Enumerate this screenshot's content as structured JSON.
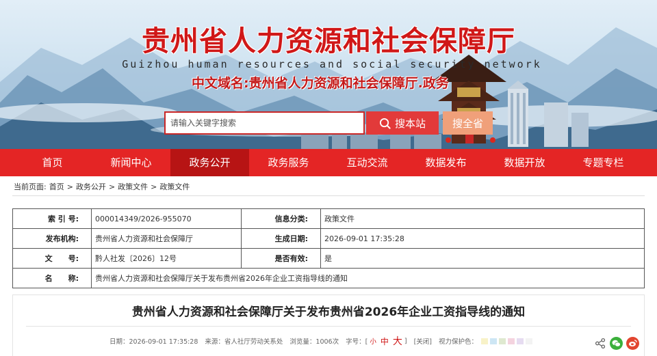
{
  "header": {
    "title": "贵州省人力资源和社会保障厅",
    "subtitle": "Guizhou human resources and social security network",
    "domain": "中文域名:贵州省人力资源和社会保障厅.政务"
  },
  "search": {
    "placeholder": "请输入关键字搜索",
    "search_label": "搜本站",
    "search_all_label": "搜全省"
  },
  "nav": {
    "items": [
      "首页",
      "新闻中心",
      "政务公开",
      "政务服务",
      "互动交流",
      "数据发布",
      "数据开放",
      "专题专栏"
    ],
    "active_index": 2
  },
  "breadcrumb": {
    "prefix": "当前页面:",
    "items": [
      "首页",
      "政务公开",
      "政策文件",
      "政策文件"
    ],
    "separator": ">"
  },
  "info": {
    "index_label": "索 引 号:",
    "index_value": "000014349/2026-955070",
    "category_label": "信息分类:",
    "category_value": "政策文件",
    "publisher_label": "发布机构:",
    "publisher_value": "贵州省人力资源和社会保障厅",
    "date_label": "生成日期:",
    "date_value": "2026-09-01 17:35:28",
    "docno_label": "文      号:",
    "docno_value": "黔人社发〔2026〕12号",
    "valid_label": "是否有效:",
    "valid_value": "是",
    "name_label": "名      称:",
    "name_value": "贵州省人力资源和社会保障厅关于发布贵州省2026年企业工资指导线的通知"
  },
  "article": {
    "title": "贵州省人力资源和社会保障厅关于发布贵州省2026年企业工资指导线的通知",
    "date": "日期：2026-09-01 17:35:28",
    "source": "来源：省人社厅劳动关系处",
    "views": "浏览量：1006次",
    "font_label": "字号：[",
    "font_small": "小",
    "font_medium": "中",
    "font_large": "大",
    "font_end": "]",
    "close_label": "[关闭]",
    "color_label": "视力保护色：",
    "swatches": [
      "#f8f2c8",
      "#cde6f4",
      "#dfe9d0",
      "#f4d3df",
      "#e6dcf1",
      "#f3f3f3"
    ]
  },
  "colors": {
    "brand_red": "#e42525",
    "nav_active": "#b71414"
  }
}
